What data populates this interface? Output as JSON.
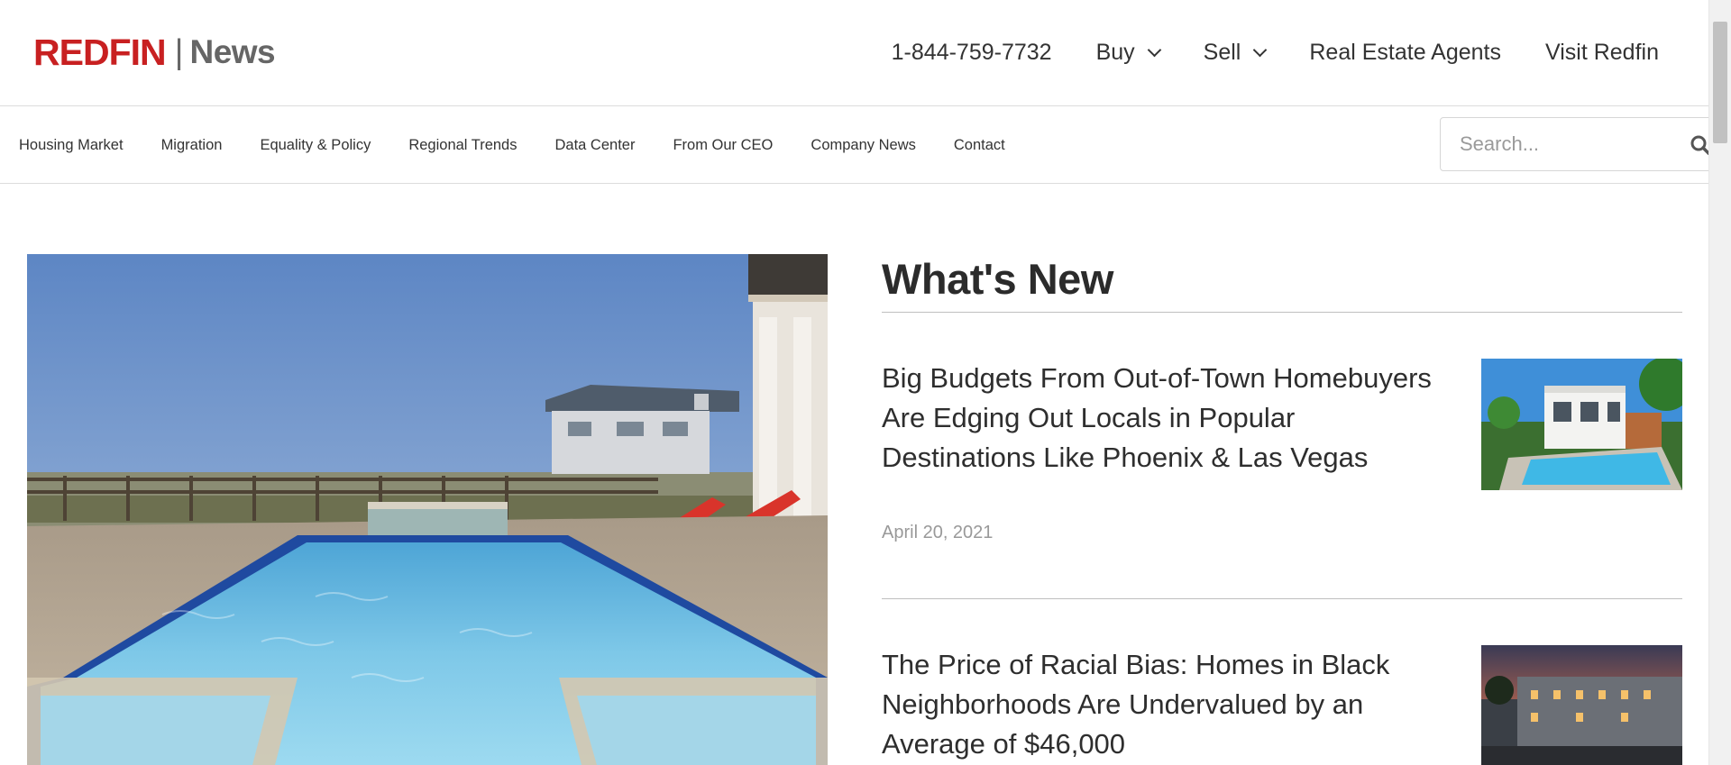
{
  "header": {
    "logo_brand": "REDFIN",
    "logo_section": "News",
    "phone": "1-844-759-7732",
    "nav": [
      {
        "label": "Buy",
        "dropdown": true
      },
      {
        "label": "Sell",
        "dropdown": true
      },
      {
        "label": "Real Estate Agents",
        "dropdown": false
      },
      {
        "label": "Visit Redfin",
        "dropdown": false
      }
    ]
  },
  "subnav": {
    "items": [
      "Housing Market",
      "Migration",
      "Equality & Policy",
      "Regional Trends",
      "Data Center",
      "From Our CEO",
      "Company News",
      "Contact"
    ],
    "search_placeholder": "Search..."
  },
  "main": {
    "section_title": "What's New",
    "articles": [
      {
        "title": "Big Budgets From Out-of-Town Homebuyers Are Edging Out Locals in Popular Destinations Like Phoenix & Las Vegas",
        "date": "April 20, 2021"
      },
      {
        "title": "The Price of Racial Bias: Homes in Black Neighborhoods Are Undervalued by an Average of $46,000",
        "date": ""
      }
    ]
  },
  "colors": {
    "brand_red": "#c82021",
    "text_dark": "#2e2e2e",
    "date_gray": "#999999",
    "divider": "#bfbfbf"
  },
  "icons": {
    "search": "search-icon",
    "dropdown": "chevron-down-icon"
  }
}
